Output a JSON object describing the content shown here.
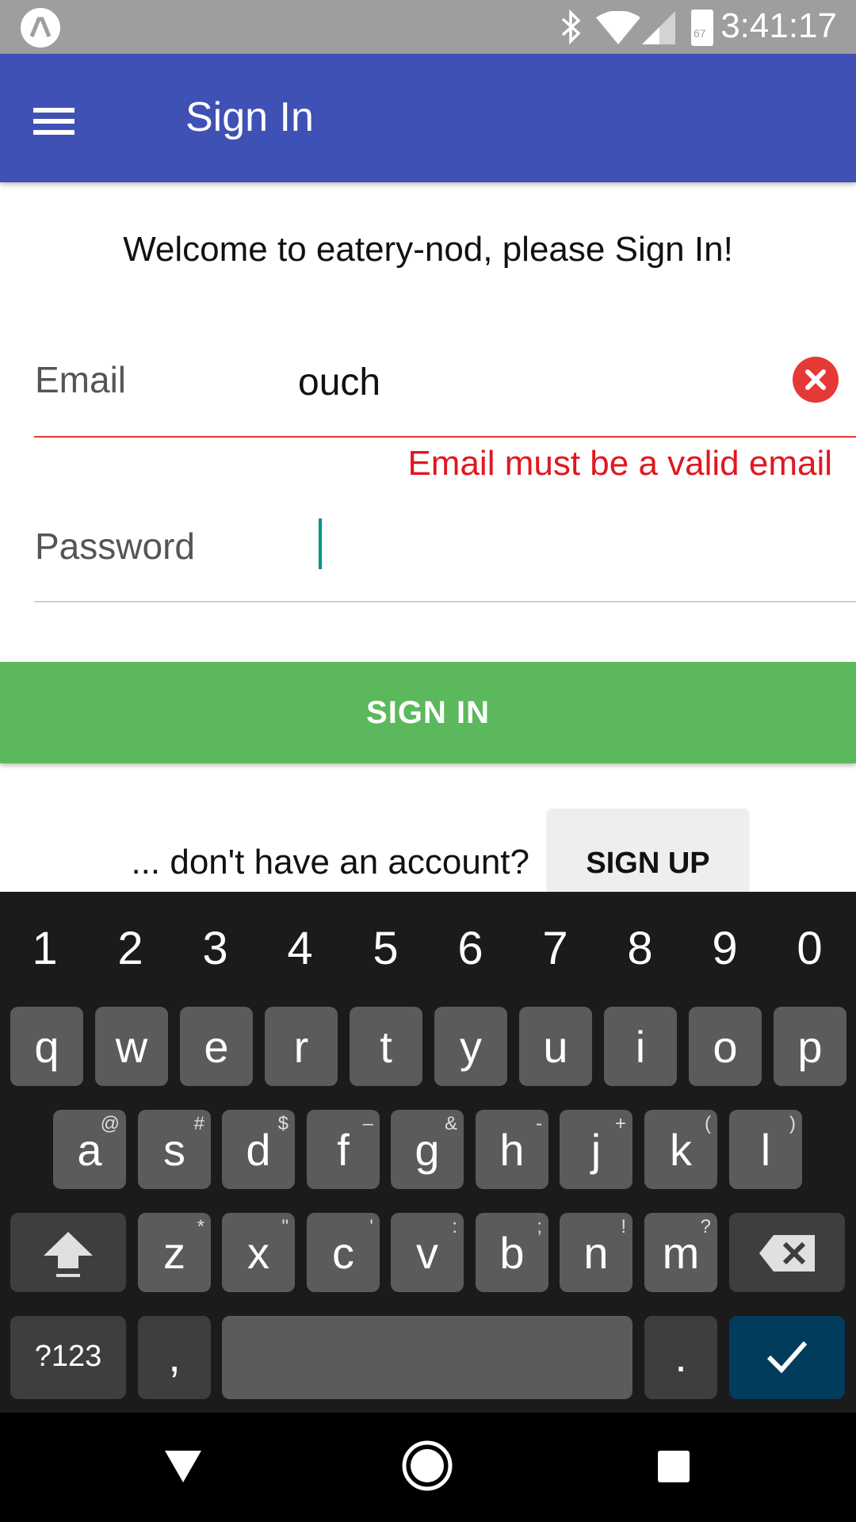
{
  "status_bar": {
    "time": "3:41:17",
    "battery_level_text": "67",
    "icons": [
      "lambda-icon",
      "bluetooth-icon",
      "wifi-icon",
      "signal-icon",
      "battery-icon"
    ]
  },
  "app_bar": {
    "title": "Sign In",
    "background_color": "#3f51b5",
    "menu_icon": "hamburger-menu-icon"
  },
  "form": {
    "welcome_text": "Welcome to eatery-nod, please Sign In!",
    "email": {
      "label": "Email",
      "value": "ouch",
      "error": "Email must be a valid email",
      "clear_icon": "clear-error-icon"
    },
    "password": {
      "label": "Password",
      "value": ""
    },
    "sign_in_label": "SIGN IN",
    "sign_in_color": "#5cb85c",
    "no_account_text": "... don't have an account?",
    "sign_up_label": "SIGN UP"
  },
  "keyboard": {
    "numbers": [
      "1",
      "2",
      "3",
      "4",
      "5",
      "6",
      "7",
      "8",
      "9",
      "0"
    ],
    "row1": [
      "q",
      "w",
      "e",
      "r",
      "t",
      "y",
      "u",
      "i",
      "o",
      "p"
    ],
    "row2": [
      {
        "key": "a",
        "hint": "@"
      },
      {
        "key": "s",
        "hint": "#"
      },
      {
        "key": "d",
        "hint": "$"
      },
      {
        "key": "f",
        "hint": "–"
      },
      {
        "key": "g",
        "hint": "&"
      },
      {
        "key": "h",
        "hint": "-"
      },
      {
        "key": "j",
        "hint": "+"
      },
      {
        "key": "k",
        "hint": "("
      },
      {
        "key": "l",
        "hint": ")"
      }
    ],
    "row3": [
      {
        "key": "z",
        "hint": "*"
      },
      {
        "key": "x",
        "hint": "\""
      },
      {
        "key": "c",
        "hint": "'"
      },
      {
        "key": "v",
        "hint": ":"
      },
      {
        "key": "b",
        "hint": ";"
      },
      {
        "key": "n",
        "hint": "!"
      },
      {
        "key": "m",
        "hint": "?"
      }
    ],
    "symbols_label": "?123",
    "comma_label": ",",
    "period_label": ".",
    "shift_icon": "shift-icon",
    "backspace_icon": "backspace-icon",
    "enter_icon": "checkmark-icon"
  },
  "nav_bar": {
    "icons": [
      "back-icon",
      "home-icon",
      "recents-icon"
    ]
  }
}
